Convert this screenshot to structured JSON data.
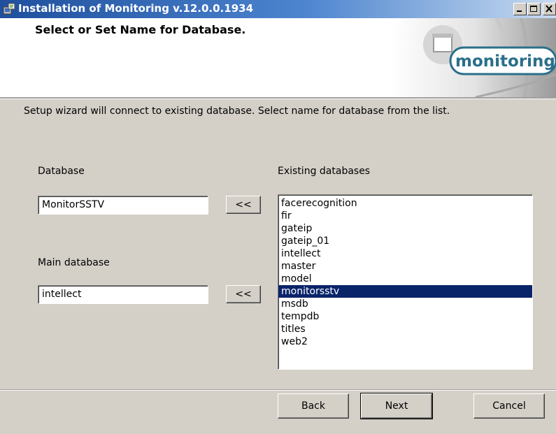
{
  "window": {
    "title": "Installation of Monitoring v.12.0.0.1934"
  },
  "banner": {
    "title": "Select or Set Name for Database.",
    "logo_text": "monitoring"
  },
  "instruction": "Setup wizard will connect to existing database. Select name for database from the list.",
  "database": {
    "label": "Database",
    "value": "MonitorSSTV",
    "copy_button": "<<"
  },
  "main_database": {
    "label": "Main database",
    "value": "intellect",
    "copy_button": "<<"
  },
  "existing": {
    "label": "Existing databases",
    "items": [
      "facerecognition",
      "fir",
      "gateip",
      "gateip_01",
      "intellect",
      "master",
      "model",
      "monitorsstv",
      "msdb",
      "tempdb",
      "titles",
      "web2"
    ],
    "selected": "monitorsstv"
  },
  "buttons": {
    "back": "Back",
    "next": "Next",
    "cancel": "Cancel"
  },
  "colors": {
    "selection": "#0a246a",
    "titlebar": "#1f4f9e",
    "logo_teal": "#2a6f8a"
  }
}
